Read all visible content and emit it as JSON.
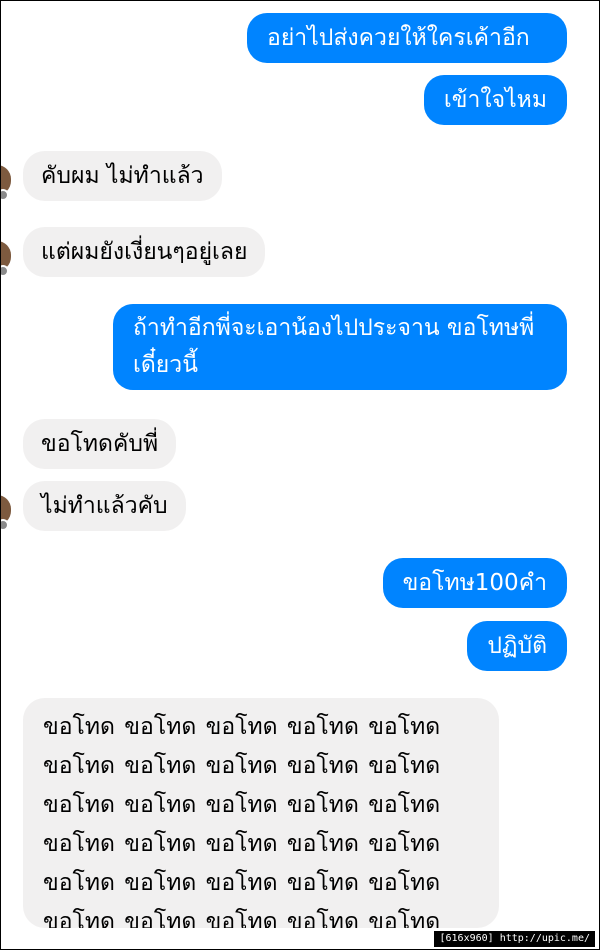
{
  "messages": {
    "m1": "อย่าไปส่งควยให้ใครเค้าอีก",
    "m2": "เข้าใจไหม",
    "m3": "คับผม ไม่ทำแล้ว",
    "m4": "แต่ผมยังเงี่ยนๆอยู่เลย",
    "m5": "ถ้าทำอีกพี่จะเอาน้องไปประจาน ขอโทษพี่เดี๋ยวนี้",
    "m6": "ขอโทดคับพี่",
    "m7": "ไม่ทำแล้วคับ",
    "m8": "ขอโทษ100คำ",
    "m9": "ปฏิบัติ",
    "m10": "ขอโทด ขอโทด ขอโทด ขอโทด ขอโทด ขอโทด ขอโทด ขอโทด ขอโทด ขอโทด ขอโทด ขอโทด ขอโทด ขอโทด ขอโทด ขอโทด ขอโทด ขอโทด ขอโทด ขอโทด ขอโทด ขอโทด ขอโทด ขอโทด ขอโทด ขอโทด ขอโทด ขอโทด ขอโทด ขอโทด ขอ"
  },
  "colors": {
    "outgoing": "#0084ff",
    "incoming": "#f1f0f0"
  },
  "footer": {
    "text": "[616x960] http://upic.me/"
  }
}
